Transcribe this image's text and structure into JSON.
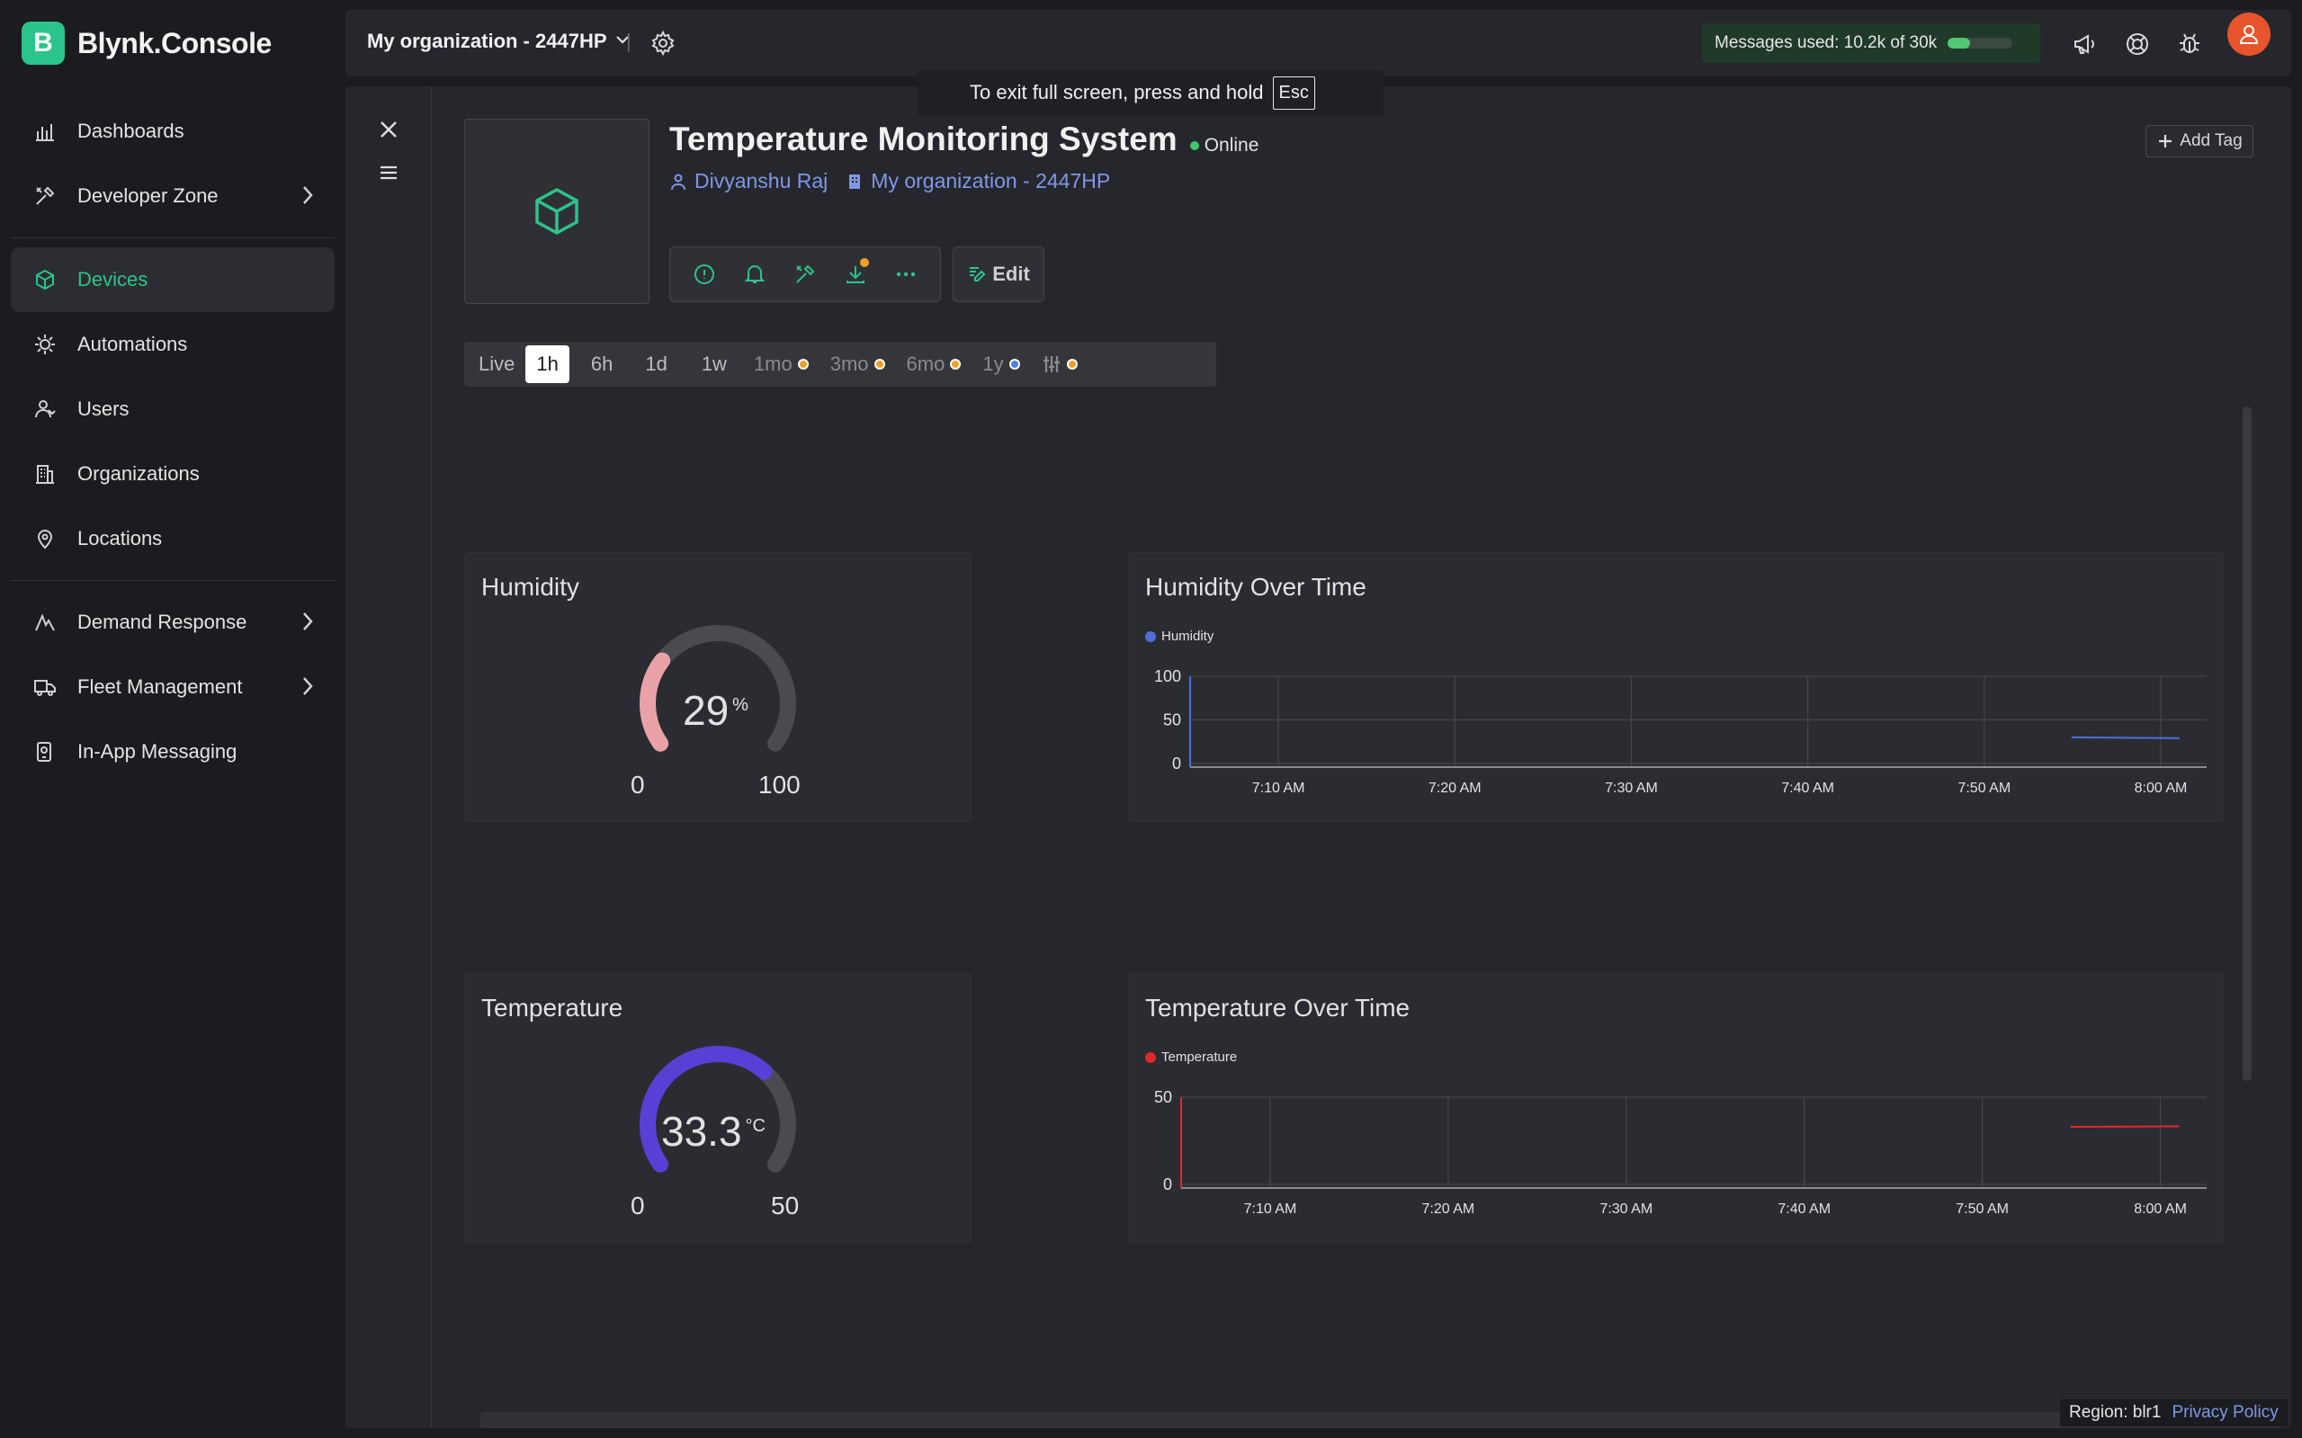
{
  "app": {
    "logo_letter": "B",
    "name": "Blynk.Console"
  },
  "sidebar": {
    "items": [
      {
        "label": "Dashboards",
        "icon": "chart-icon"
      },
      {
        "label": "Developer Zone",
        "icon": "tools-icon"
      },
      {
        "label": "Devices",
        "icon": "cube-icon",
        "active": true
      },
      {
        "label": "Automations",
        "icon": "automation-icon"
      },
      {
        "label": "Users",
        "icon": "users-icon"
      },
      {
        "label": "Organizations",
        "icon": "building-icon"
      },
      {
        "label": "Locations",
        "icon": "pin-icon"
      },
      {
        "label": "Demand Response",
        "icon": "demand-icon"
      },
      {
        "label": "Fleet Management",
        "icon": "truck-icon"
      },
      {
        "label": "In-App Messaging",
        "icon": "message-icon"
      }
    ]
  },
  "topbar": {
    "org_name": "My organization - 2447HP",
    "separator": "|",
    "messages_used": "Messages used: 10.2k of 30k",
    "messages_fraction": 0.34
  },
  "toast": {
    "text": "To exit full screen, press and hold",
    "key": "Esc"
  },
  "device": {
    "title": "Temperature Monitoring System",
    "status": "Online",
    "owner": "Divyanshu Raj",
    "org": "My organization - 2447HP",
    "edit_label": "Edit",
    "add_tag_label": "Add Tag"
  },
  "time_ranges": [
    "Live",
    "1h",
    "6h",
    "1d",
    "1w",
    "1mo",
    "3mo",
    "6mo",
    "1y"
  ],
  "selected_range": "1h",
  "widgets": {
    "humidity_gauge": {
      "title": "Humidity",
      "value": "29",
      "unit": "%",
      "min": "0",
      "max": "100",
      "color": "#e9a3a8"
    },
    "temperature_gauge": {
      "title": "Temperature",
      "value": "33.3",
      "unit": "°C",
      "min": "0",
      "max": "50",
      "color": "#5a3fd6"
    },
    "humidity_chart": {
      "title": "Humidity Over Time",
      "legend": "Humidity",
      "color": "#4e6fd8"
    },
    "temperature_chart": {
      "title": "Temperature Over Time",
      "legend": "Temperature",
      "color": "#e0282c"
    }
  },
  "chart_data": [
    {
      "type": "line",
      "title": "Humidity Over Time",
      "x_ticks": [
        "7:10 AM",
        "7:20 AM",
        "7:30 AM",
        "7:40 AM",
        "7:50 AM",
        "8:00 AM"
      ],
      "y_ticks": [
        "100",
        "50",
        "0"
      ],
      "ylim": [
        0,
        100
      ],
      "series": [
        {
          "name": "Humidity",
          "color": "#4e6fd8",
          "points": [
            {
              "x": "7:55 AM",
              "y": 30
            },
            {
              "x": "7:58 AM",
              "y": 29.5
            },
            {
              "x": "8:01 AM",
              "y": 29
            }
          ]
        }
      ]
    },
    {
      "type": "line",
      "title": "Temperature Over Time",
      "x_ticks": [
        "7:10 AM",
        "7:20 AM",
        "7:30 AM",
        "7:40 AM",
        "7:50 AM",
        "8:00 AM"
      ],
      "y_ticks": [
        "50",
        "0"
      ],
      "ylim": [
        0,
        50
      ],
      "series": [
        {
          "name": "Temperature",
          "color": "#e0282c",
          "points": [
            {
              "x": "7:55 AM",
              "y": 33
            },
            {
              "x": "7:58 AM",
              "y": 33.1
            },
            {
              "x": "8:01 AM",
              "y": 33.3
            }
          ]
        }
      ]
    }
  ],
  "footer": {
    "region": "Region: blr1",
    "privacy": "Privacy Policy"
  }
}
